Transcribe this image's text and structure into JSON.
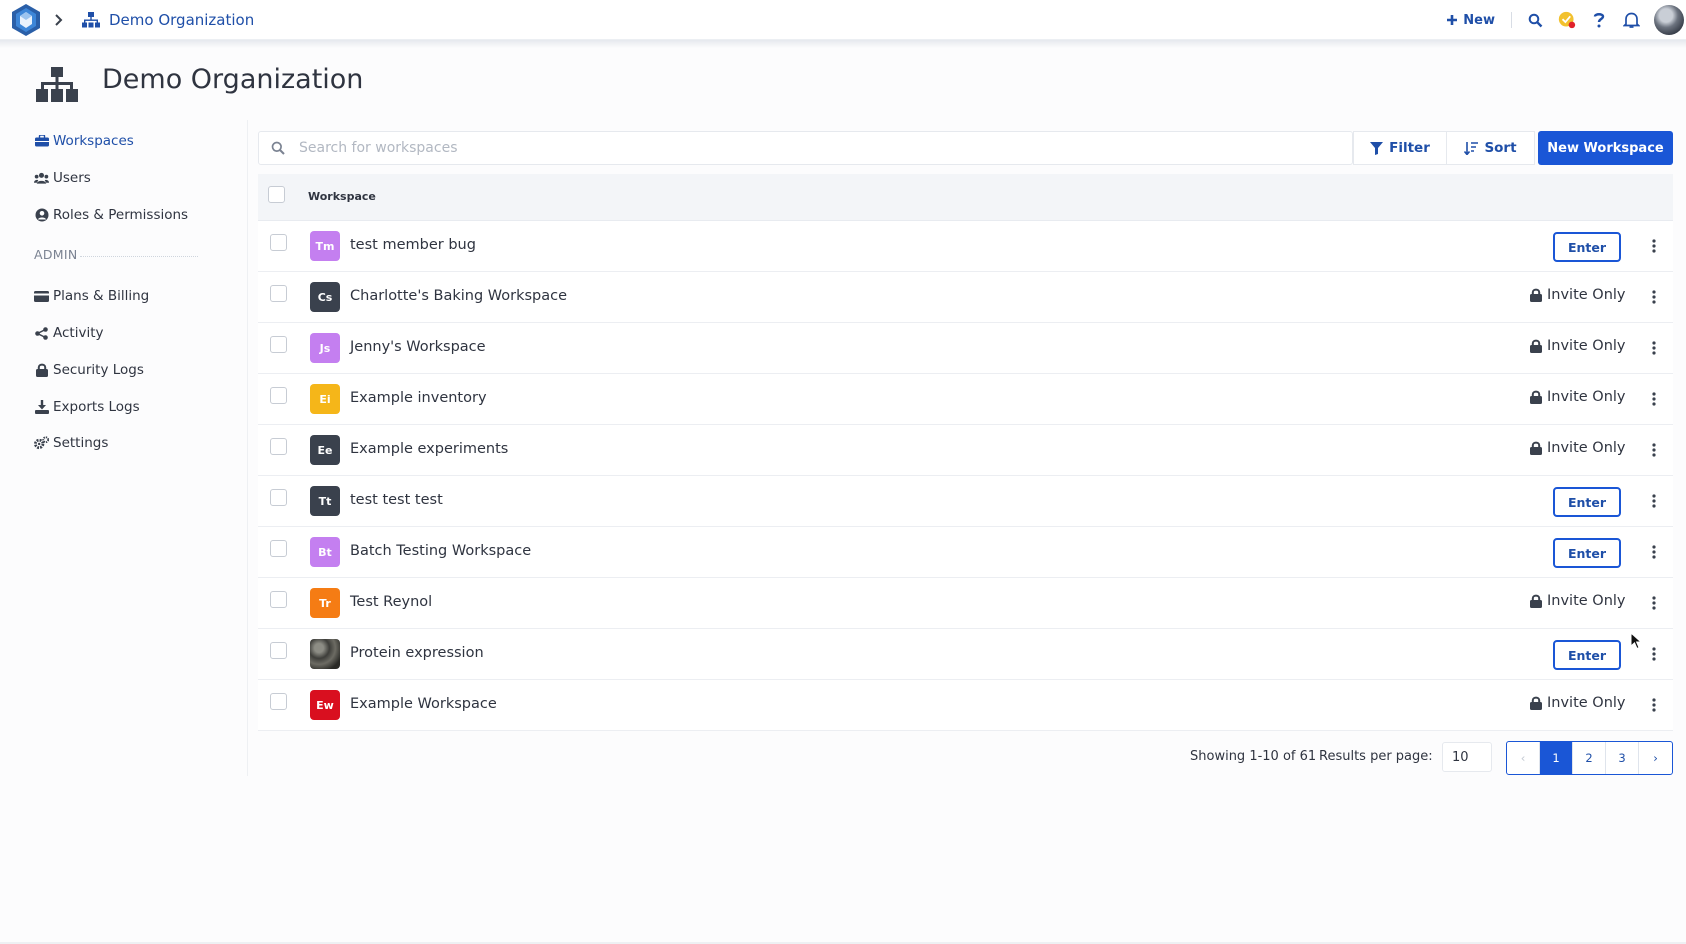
{
  "topbar": {
    "breadcrumb_org": "Demo Organization",
    "new_label": "New"
  },
  "page": {
    "title": "Demo Organization"
  },
  "sidebar": {
    "items": [
      {
        "label": "Workspaces",
        "icon": "briefcase-icon",
        "active": true
      },
      {
        "label": "Users",
        "icon": "users-icon"
      },
      {
        "label": "Roles & Permissions",
        "icon": "user-circle-icon"
      }
    ],
    "admin_label": "ADMIN",
    "admin_items": [
      {
        "label": "Plans & Billing",
        "icon": "credit-card-icon"
      },
      {
        "label": "Activity",
        "icon": "share-icon"
      },
      {
        "label": "Security Logs",
        "icon": "lock-icon"
      },
      {
        "label": "Exports Logs",
        "icon": "download-icon"
      },
      {
        "label": "Settings",
        "icon": "gears-icon"
      }
    ]
  },
  "toolbar": {
    "search_placeholder": "Search for workspaces",
    "filter_label": "Filter",
    "sort_label": "Sort",
    "new_workspace_label": "New Workspace"
  },
  "table": {
    "header": "Workspace",
    "enter_label": "Enter",
    "invite_label": "Invite Only",
    "rows": [
      {
        "initials": "Tm",
        "name": "test member bug",
        "color": "#c47ff0",
        "access": "enter"
      },
      {
        "initials": "Cs",
        "name": "Charlotte's Baking Workspace",
        "color": "#3a414d",
        "access": "invite"
      },
      {
        "initials": "Js",
        "name": "Jenny's Workspace",
        "color": "#c47ff0",
        "access": "invite"
      },
      {
        "initials": "Ei",
        "name": "Example inventory",
        "color": "#f5b619",
        "access": "invite"
      },
      {
        "initials": "Ee",
        "name": "Example experiments",
        "color": "#3a414d",
        "access": "invite"
      },
      {
        "initials": "Tt",
        "name": "test test test",
        "color": "#3a414d",
        "access": "enter"
      },
      {
        "initials": "Bt",
        "name": "Batch Testing Workspace",
        "color": "#c47ff0",
        "access": "enter"
      },
      {
        "initials": "Tr",
        "name": "Test Reynol",
        "color": "#f57c14",
        "access": "invite"
      },
      {
        "initials": "",
        "name": "Protein expression",
        "color": "#3e3e3a",
        "access": "enter",
        "image": true
      },
      {
        "initials": "Ew",
        "name": "Example Workspace",
        "color": "#d90f1f",
        "access": "invite"
      }
    ]
  },
  "pagination": {
    "showing": "Showing 1-10 of 61",
    "results_per_page_label": "Results per page:",
    "results_per_page": "10",
    "pages": [
      "1",
      "2",
      "3"
    ],
    "prev": "‹",
    "next": "›"
  },
  "colors": {
    "accent": "#1a56d6",
    "link": "#1f4fa8"
  }
}
